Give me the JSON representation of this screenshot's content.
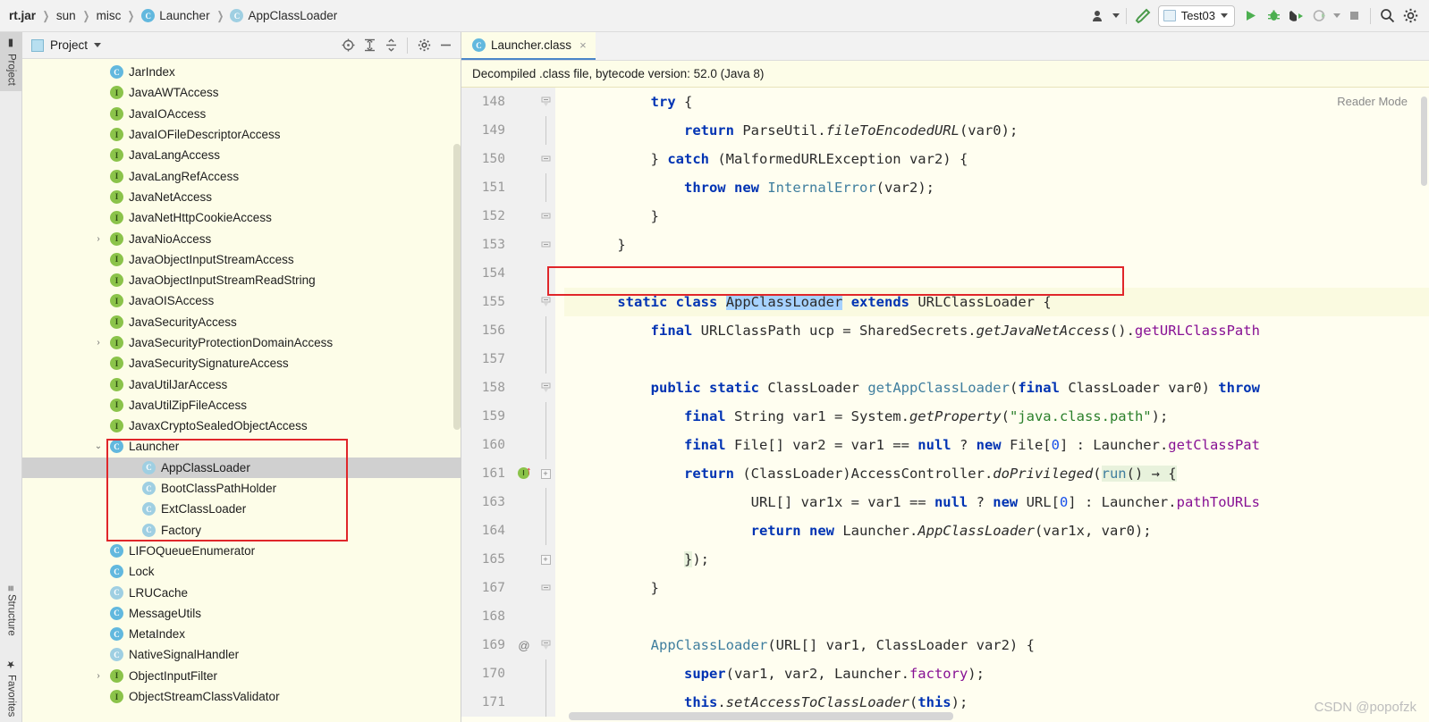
{
  "breadcrumb": [
    {
      "label": "rt.jar",
      "icon": null,
      "bold": true
    },
    {
      "label": "sun",
      "icon": null,
      "bold": false
    },
    {
      "label": "misc",
      "icon": null,
      "bold": false
    },
    {
      "label": "Launcher",
      "icon": "class-icon",
      "bold": false
    },
    {
      "label": "AppClassLoader",
      "icon": "class-icon",
      "bold": false
    }
  ],
  "toolbar": {
    "user_icon": "user-avatar-icon",
    "build_icon": "build-hammer-icon",
    "run_config": "Test03",
    "run_icon": "run-play-icon",
    "debug_icon": "debug-bug-icon",
    "coverage_icon": "run-with-coverage-icon",
    "profile_icon": "profiler-icon",
    "stop_icon": "stop-icon",
    "search_icon": "search-icon",
    "settings_icon": "gear-icon"
  },
  "tool_windows": {
    "left_top": "Project",
    "left_bottom": [
      "Structure",
      "Favorites"
    ]
  },
  "project_panel": {
    "title": "Project",
    "actions": [
      "locate-icon",
      "expand-all-icon",
      "collapse-all-icon",
      "gear-icon",
      "hide-icon"
    ],
    "tree": [
      {
        "label": "JarIndex",
        "kind": "class",
        "indent": 2,
        "arrow": "",
        "selected": false
      },
      {
        "label": "JavaAWTAccess",
        "kind": "interface",
        "indent": 2,
        "arrow": "",
        "selected": false
      },
      {
        "label": "JavaIOAccess",
        "kind": "interface",
        "indent": 2,
        "arrow": "",
        "selected": false
      },
      {
        "label": "JavaIOFileDescriptorAccess",
        "kind": "interface",
        "indent": 2,
        "arrow": "",
        "selected": false
      },
      {
        "label": "JavaLangAccess",
        "kind": "interface",
        "indent": 2,
        "arrow": "",
        "selected": false
      },
      {
        "label": "JavaLangRefAccess",
        "kind": "interface",
        "indent": 2,
        "arrow": "",
        "selected": false
      },
      {
        "label": "JavaNetAccess",
        "kind": "interface",
        "indent": 2,
        "arrow": "",
        "selected": false
      },
      {
        "label": "JavaNetHttpCookieAccess",
        "kind": "interface",
        "indent": 2,
        "arrow": "",
        "selected": false
      },
      {
        "label": "JavaNioAccess",
        "kind": "interface",
        "indent": 2,
        "arrow": "›",
        "selected": false
      },
      {
        "label": "JavaObjectInputStreamAccess",
        "kind": "interface",
        "indent": 2,
        "arrow": "",
        "selected": false
      },
      {
        "label": "JavaObjectInputStreamReadString",
        "kind": "interface",
        "indent": 2,
        "arrow": "",
        "selected": false
      },
      {
        "label": "JavaOISAccess",
        "kind": "interface",
        "indent": 2,
        "arrow": "",
        "selected": false
      },
      {
        "label": "JavaSecurityAccess",
        "kind": "interface",
        "indent": 2,
        "arrow": "",
        "selected": false
      },
      {
        "label": "JavaSecurityProtectionDomainAccess",
        "kind": "interface",
        "indent": 2,
        "arrow": "›",
        "selected": false
      },
      {
        "label": "JavaSecuritySignatureAccess",
        "kind": "interface",
        "indent": 2,
        "arrow": "",
        "selected": false
      },
      {
        "label": "JavaUtilJarAccess",
        "kind": "interface",
        "indent": 2,
        "arrow": "",
        "selected": false
      },
      {
        "label": "JavaUtilZipFileAccess",
        "kind": "interface",
        "indent": 2,
        "arrow": "",
        "selected": false
      },
      {
        "label": "JavaxCryptoSealedObjectAccess",
        "kind": "interface",
        "indent": 2,
        "arrow": "",
        "selected": false
      },
      {
        "label": "Launcher",
        "kind": "class",
        "indent": 2,
        "arrow": "⌄",
        "selected": false
      },
      {
        "label": "AppClassLoader",
        "kind": "class-muted",
        "indent": 3,
        "arrow": "",
        "selected": true
      },
      {
        "label": "BootClassPathHolder",
        "kind": "class-muted",
        "indent": 3,
        "arrow": "",
        "selected": false
      },
      {
        "label": "ExtClassLoader",
        "kind": "class-muted",
        "indent": 3,
        "arrow": "",
        "selected": false
      },
      {
        "label": "Factory",
        "kind": "class-muted",
        "indent": 3,
        "arrow": "",
        "selected": false
      },
      {
        "label": "LIFOQueueEnumerator",
        "kind": "class",
        "indent": 2,
        "arrow": "",
        "selected": false
      },
      {
        "label": "Lock",
        "kind": "class",
        "indent": 2,
        "arrow": "",
        "selected": false
      },
      {
        "label": "LRUCache",
        "kind": "class-muted",
        "indent": 2,
        "arrow": "",
        "selected": false
      },
      {
        "label": "MessageUtils",
        "kind": "class",
        "indent": 2,
        "arrow": "",
        "selected": false
      },
      {
        "label": "MetaIndex",
        "kind": "class",
        "indent": 2,
        "arrow": "",
        "selected": false
      },
      {
        "label": "NativeSignalHandler",
        "kind": "class-muted",
        "indent": 2,
        "arrow": "",
        "selected": false
      },
      {
        "label": "ObjectInputFilter",
        "kind": "interface",
        "indent": 2,
        "arrow": "›",
        "selected": false
      },
      {
        "label": "ObjectStreamClassValidator",
        "kind": "interface",
        "indent": 2,
        "arrow": "",
        "selected": false
      }
    ]
  },
  "editor": {
    "tab": {
      "label": "Launcher.class",
      "icon": "class-icon",
      "close": "×"
    },
    "notice": "Decompiled .class file, bytecode version: 52.0 (Java 8)",
    "reader_mode": "Reader Mode",
    "watermark": "CSDN @popofzk",
    "lines": [
      {
        "num": "148",
        "fold": "collapse-top",
        "gutter": "",
        "hl": false,
        "text": "        try {"
      },
      {
        "num": "149",
        "fold": "bar",
        "gutter": "",
        "hl": false,
        "text": "            return ParseUtil.fileToEncodedURL(var0);"
      },
      {
        "num": "150",
        "fold": "bracket",
        "gutter": "",
        "hl": false,
        "text": "        } catch (MalformedURLException var2) {"
      },
      {
        "num": "151",
        "fold": "bar",
        "gutter": "",
        "hl": false,
        "text": "            throw new InternalError(var2);"
      },
      {
        "num": "152",
        "fold": "bracket",
        "gutter": "",
        "hl": false,
        "text": "        }"
      },
      {
        "num": "153",
        "fold": "bracket",
        "gutter": "",
        "hl": false,
        "text": "    }"
      },
      {
        "num": "154",
        "fold": "",
        "gutter": "",
        "hl": false,
        "text": ""
      },
      {
        "num": "155",
        "fold": "collapse-top",
        "gutter": "",
        "hl": true,
        "text": "    static class AppClassLoader extends URLClassLoader {"
      },
      {
        "num": "156",
        "fold": "bar",
        "gutter": "",
        "hl": false,
        "text": "        final URLClassPath ucp = SharedSecrets.getJavaNetAccess().getURLClassPath"
      },
      {
        "num": "157",
        "fold": "bar",
        "gutter": "",
        "hl": false,
        "text": ""
      },
      {
        "num": "158",
        "fold": "collapse-top",
        "gutter": "",
        "hl": false,
        "text": "        public static ClassLoader getAppClassLoader(final ClassLoader var0) throw"
      },
      {
        "num": "159",
        "fold": "bar",
        "gutter": "",
        "hl": false,
        "text": "            final String var1 = System.getProperty(\"java.class.path\");"
      },
      {
        "num": "160",
        "fold": "bar",
        "gutter": "",
        "hl": false,
        "text": "            final File[] var2 = var1 == null ? new File[0] : Launcher.getClassPat"
      },
      {
        "num": "161",
        "fold": "plus",
        "gutter": "impl",
        "hl": false,
        "text": "            return (ClassLoader)AccessController.doPrivileged(run() → {"
      },
      {
        "num": "163",
        "fold": "bar",
        "gutter": "",
        "hl": false,
        "text": "                    URL[] var1x = var1 == null ? new URL[0] : Launcher.pathToURLs"
      },
      {
        "num": "164",
        "fold": "bar",
        "gutter": "",
        "hl": false,
        "text": "                    return new Launcher.AppClassLoader(var1x, var0);"
      },
      {
        "num": "165",
        "fold": "plus",
        "gutter": "",
        "hl": false,
        "text": "            });"
      },
      {
        "num": "167",
        "fold": "bracket",
        "gutter": "",
        "hl": false,
        "text": "        }"
      },
      {
        "num": "168",
        "fold": "",
        "gutter": "",
        "hl": false,
        "text": ""
      },
      {
        "num": "169",
        "fold": "collapse-top",
        "gutter": "@",
        "hl": false,
        "text": "        AppClassLoader(URL[] var1, ClassLoader var2) {"
      },
      {
        "num": "170",
        "fold": "bar",
        "gutter": "",
        "hl": false,
        "text": "            super(var1, var2, Launcher.factory);"
      },
      {
        "num": "171",
        "fold": "bar",
        "gutter": "",
        "hl": false,
        "text": "            this.setAccessToClassLoader(this);"
      }
    ]
  },
  "colors": {
    "keyword": "#0033b3",
    "string": "#2a7f2a",
    "number": "#1750eb",
    "field": "#871094",
    "class_ref": "#3f7e9e",
    "selection": "#a6d2ff",
    "lambda_highlight": "#e8f2dc",
    "annotation_box": "#e0262a",
    "editor_bg": "#fffef0",
    "tree_bg": "#fdfde8",
    "accent": "#4a86c8"
  }
}
